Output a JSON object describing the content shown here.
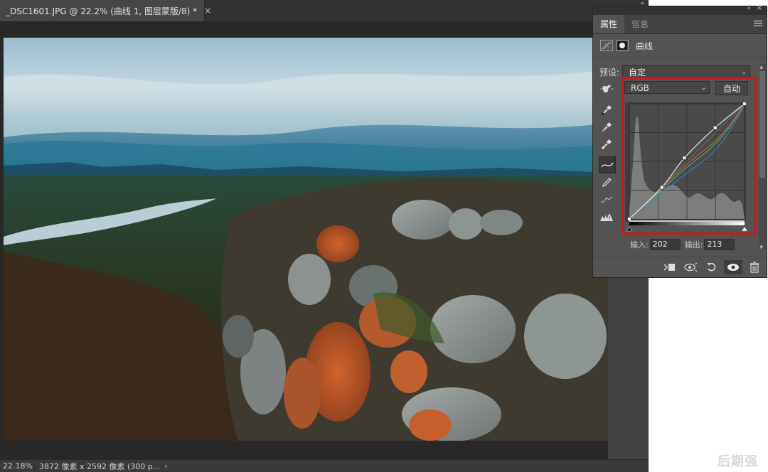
{
  "document": {
    "tab_title": "_DSC1601.JPG @ 22.2% (曲线 1, 图层蒙版/8) *",
    "close_glyph": "×",
    "collapse_glyph": "«"
  },
  "status": {
    "zoom": "22.18%",
    "info": "3872 像素 x 2592 像素 (300 p...",
    "arrow": "›"
  },
  "watermark": "后期强",
  "panel": {
    "collapse_glyph": "«",
    "close_glyph": "×",
    "tabs": [
      {
        "label": "属性",
        "active": true
      },
      {
        "label": "信息",
        "active": false
      }
    ],
    "menu_icon": "hamburger-menu-icon",
    "adjustment_title": "曲线",
    "preset_label": "预设:",
    "preset_value": "自定",
    "channel_value": "RGB",
    "auto_label": "自动",
    "input_label": "输入:",
    "input_value": "202",
    "output_label": "输出:",
    "output_value": "213",
    "tool_icons": [
      "on-image-adjust-icon",
      "black-point-eyedropper-icon",
      "gray-point-eyedropper-icon",
      "white-point-eyedropper-icon",
      "curve-edit-points-icon",
      "pencil-draw-icon",
      "smooth-curve-icon",
      "clipping-warning-icon"
    ],
    "footer_icons": [
      "clip-to-layer-icon",
      "view-previous-state-icon",
      "reset-icon",
      "visibility-eye-icon",
      "trash-icon"
    ]
  },
  "curve": {
    "input_range": [
      0,
      255
    ],
    "output_range": [
      0,
      255
    ],
    "points": [
      [
        0,
        0
      ],
      [
        72,
        70
      ],
      [
        122,
        135
      ],
      [
        190,
        202
      ],
      [
        255,
        255
      ]
    ],
    "selected_point": [
      202,
      213
    ]
  },
  "colors": {
    "highlight": "#c8191c",
    "panel_bg": "#535353",
    "canvas_bg": "#282828"
  }
}
